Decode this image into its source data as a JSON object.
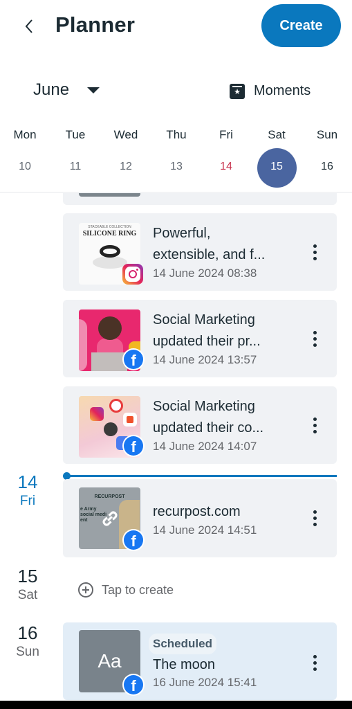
{
  "header": {
    "back_icon": "chevron-left-icon",
    "title": "Planner",
    "create_label": "Create"
  },
  "month_row": {
    "month": "June",
    "month_caret_icon": "caret-down-icon",
    "moments_icon": "bookmark-star-icon",
    "moments_label": "Moments"
  },
  "week": {
    "days": [
      {
        "name": "Mon",
        "num": "10",
        "state": "past"
      },
      {
        "name": "Tue",
        "num": "11",
        "state": "past"
      },
      {
        "name": "Wed",
        "num": "12",
        "state": "past"
      },
      {
        "name": "Thu",
        "num": "13",
        "state": "past"
      },
      {
        "name": "Fri",
        "num": "14",
        "state": "today"
      },
      {
        "name": "Sat",
        "num": "15",
        "state": "selected"
      },
      {
        "name": "Sun",
        "num": "16",
        "state": "future"
      }
    ],
    "colors": {
      "today": "#c8334e",
      "selected_bg": "#4a65a0"
    }
  },
  "feed": {
    "posts": [
      {
        "title_line1": "Powerful,",
        "title_line2": "extensible, and f...",
        "date": "14 June 2024 08:38",
        "platform": "instagram-icon",
        "thumbnail": {
          "brand": "STACKABLE COLLECTION",
          "name": "SILICONE RING"
        }
      },
      {
        "title_line1": "Social Marketing",
        "title_line2": "updated their pr...",
        "date": "14 June 2024 13:57",
        "platform": "facebook-icon"
      },
      {
        "title_line1": "Social Marketing",
        "title_line2": "updated their co...",
        "date": "14 June 2024 14:07",
        "platform": "facebook-icon"
      }
    ],
    "day_14": {
      "num": "14",
      "dow": "Fri",
      "post": {
        "title": "recurpost.com",
        "date": "14 June 2024 14:51",
        "platform": "facebook-icon",
        "thumbnail": {
          "logo": "RECURPOST",
          "text": "e Army\nsocial medi\nent",
          "overlay_icon": "link-icon"
        }
      }
    },
    "day_15": {
      "num": "15",
      "dow": "Sat",
      "tap_label": "Tap to create"
    },
    "day_16": {
      "num": "16",
      "dow": "Sun",
      "post": {
        "status": "Scheduled",
        "title": "The moon",
        "date": "16 June 2024 15:41",
        "platform": "facebook-icon",
        "thumbnail_text": "Aa"
      }
    },
    "facebook_glyph": "f"
  },
  "colors": {
    "accent": "#0a78be",
    "facebook": "#1877f2",
    "card_bg": "#f0f2f5",
    "scheduled_card_bg": "#e2edf7"
  }
}
